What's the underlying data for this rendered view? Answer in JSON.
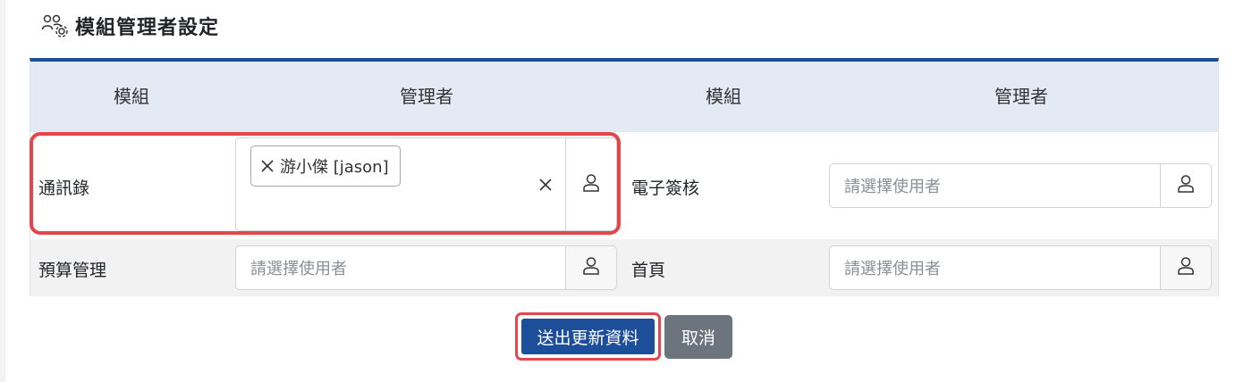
{
  "page": {
    "title": "模組管理者設定",
    "title_icon": "users-gear-icon"
  },
  "table": {
    "headers": [
      "模組",
      "管理者",
      "模組",
      "管理者"
    ],
    "rows": [
      {
        "left": {
          "module": "通訊錄",
          "selected_tags": [
            "游小傑 [jason]"
          ],
          "placeholder": ""
        },
        "right": {
          "module": "電子簽核",
          "selected_tags": [],
          "placeholder": "請選擇使用者"
        }
      },
      {
        "left": {
          "module": "預算管理",
          "selected_tags": [],
          "placeholder": "請選擇使用者"
        },
        "right": {
          "module": "首頁",
          "selected_tags": [],
          "placeholder": "請選擇使用者"
        }
      }
    ]
  },
  "actions": {
    "submit_label": "送出更新資料",
    "cancel_label": "取消"
  },
  "colors": {
    "primary": "#1c4e9a",
    "highlight": "#e4464d",
    "header_bg": "#e4eaf4",
    "secondary": "#6c757d"
  }
}
